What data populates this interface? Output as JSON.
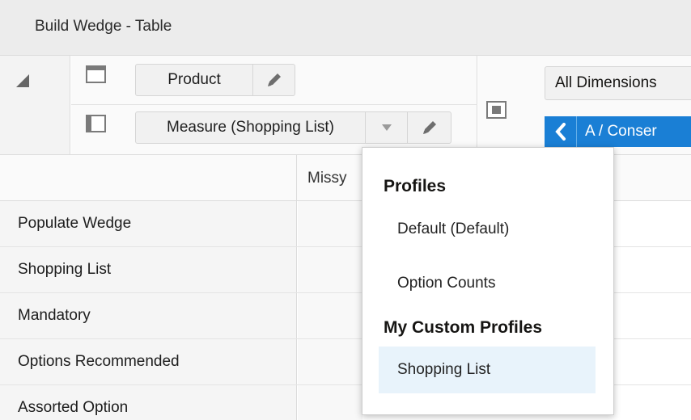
{
  "window": {
    "title": "Build Wedge - Table"
  },
  "axes": {
    "row_axis_chip": {
      "label": "Product"
    },
    "column_axis_chip": {
      "label": "Measure (Shopping List)"
    },
    "page_axis_chip": {
      "label": "All Dimensions"
    },
    "page_nav": {
      "label": "A / Conser"
    }
  },
  "grid": {
    "column_headers": [
      "Missy"
    ],
    "rows": [
      {
        "label": "Populate Wedge"
      },
      {
        "label": "Shopping List"
      },
      {
        "label": "Mandatory"
      },
      {
        "label": "Options Recommended"
      },
      {
        "label": "Assorted Option"
      }
    ]
  },
  "profiles_menu": {
    "group1": {
      "title": "Profiles",
      "items": [
        "Default (Default)",
        "Option Counts"
      ]
    },
    "group2": {
      "title": "My Custom Profiles",
      "items": [
        "Shopping List"
      ]
    },
    "selected": "Shopping List"
  },
  "icons": {
    "corner": "triangle-corner-icon",
    "row_axis": "row-axis-icon",
    "column_axis": "column-axis-icon",
    "page_axis": "page-axis-icon",
    "edit": "pencil-icon",
    "dropdown": "caret-down-icon",
    "previous": "chevron-left-icon"
  },
  "colors": {
    "accent": "#1a7fd5",
    "selected_item": "#e8f3fb",
    "header_bg": "#ececec"
  }
}
